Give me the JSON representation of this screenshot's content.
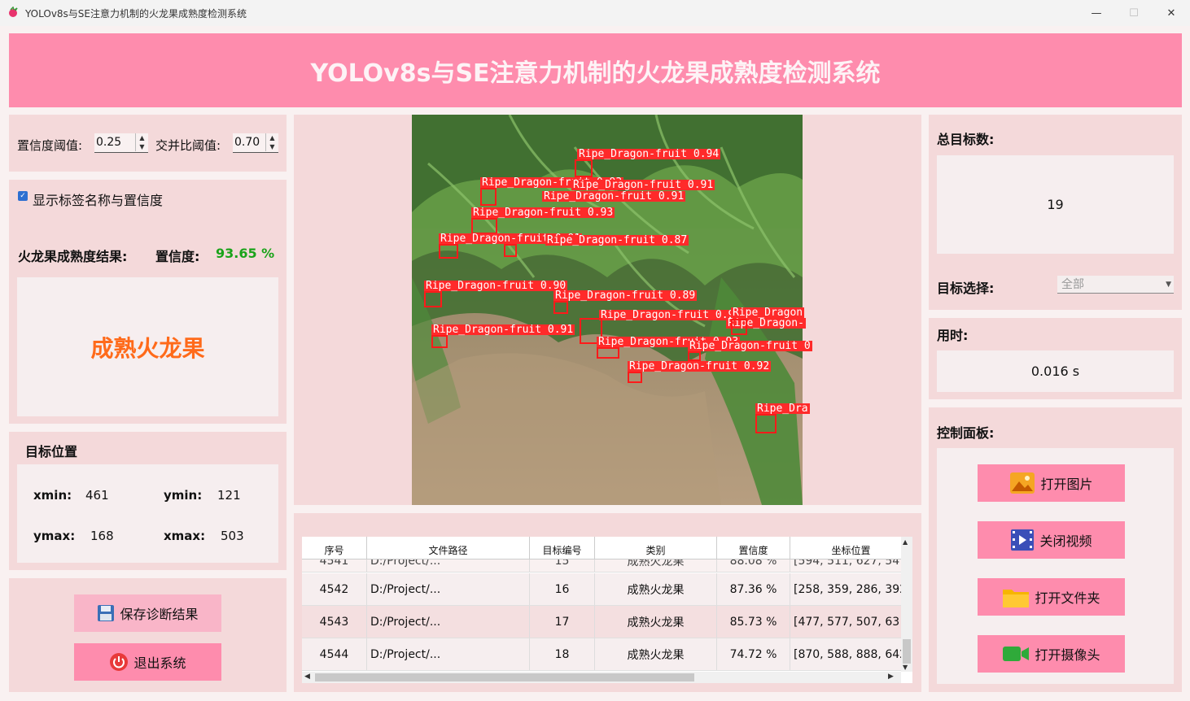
{
  "window": {
    "title": "YOLOv8s与SE注意力机制的火龙果成熟度检测系统",
    "minimize": "—",
    "maximize": "☐",
    "close": "✕"
  },
  "header": {
    "title": "YOLOv8s与SE注意力机制的火龙果成熟度检测系统"
  },
  "settings": {
    "conf_label": "置信度阈值:",
    "conf_value": "0.25",
    "iou_label": "交并比阈值:",
    "iou_value": "0.70"
  },
  "display": {
    "show_labels_text": "显示标签名称与置信度",
    "result_label": "火龙果成熟度结果:",
    "confidence_label": "置信度:",
    "confidence_value": "93.65 %",
    "result_value": "成熟火龙果"
  },
  "target_position": {
    "title": "目标位置",
    "xmin_label": "xmin:",
    "xmin_value": "461",
    "ymin_label": "ymin:",
    "ymin_value": "121",
    "ymax_label": "ymax:",
    "ymax_value": "168",
    "xmax_label": "xmax:",
    "xmax_value": "503"
  },
  "actions": {
    "save_label": "保存诊断结果",
    "exit_label": "退出系统"
  },
  "stats": {
    "total_label": "总目标数:",
    "total_value": "19",
    "select_label": "目标选择:",
    "select_value": "全部",
    "time_label": "用时:",
    "time_value": "0.016 s"
  },
  "control": {
    "title": "控制面板:",
    "open_image": "打开图片",
    "close_video": "关闭视频",
    "open_folder": "打开文件夹",
    "open_camera": "打开摄像头"
  },
  "table": {
    "headers": [
      "序号",
      "文件路径",
      "目标编号",
      "类别",
      "置信度",
      "坐标位置"
    ],
    "partial_row": [
      "4541",
      "D:/Project/...",
      "15",
      "成熟火龙果",
      "88.08 %",
      "[594, 511, 627, 54"
    ],
    "rows": [
      [
        "4542",
        "D:/Project/...",
        "16",
        "成熟火龙果",
        "87.36 %",
        "[258, 359, 286, 392"
      ],
      [
        "4543",
        "D:/Project/...",
        "17",
        "成熟火龙果",
        "85.73 %",
        "[477, 577, 507, 63"
      ],
      [
        "4544",
        "D:/Project/...",
        "18",
        "成熟火龙果",
        "74.72 %",
        "[870, 588, 888, 642"
      ]
    ]
  },
  "detections": [
    "Ripe_Dragon-fruit 0.94",
    "Ripe_Dragon-fruit 0.93",
    "Ripe_Dragon-fruit 0.91",
    "Ripe_Dragon-fruit 0.91",
    "Ripe_Dragon-fruit 0.93",
    "Ripe_Dragon-fruit 0.91",
    "Ripe_Dragon-fruit 0.87",
    "Ripe_Dragon-fruit 0.90",
    "Ripe_Dragon-fruit 0.89",
    "Ripe_Dragon-fruit 0.93",
    "Ripe_Dragon",
    "Ripe_Dragon-",
    "Ripe_Dragon-fruit 0.91",
    "Ripe_Dragon-fruit 0.93",
    "Ripe_Dragon-fruit 0",
    "Ripe_Dragon-fruit 0.92",
    "Ripe_Dra"
  ],
  "colors": {
    "accent_pink": "#fe8cad",
    "panel_bg": "#f4d9da",
    "result_orange": "#ff6a1a",
    "confidence_green": "#1aa31a",
    "detection_red": "#ff2a2a"
  }
}
